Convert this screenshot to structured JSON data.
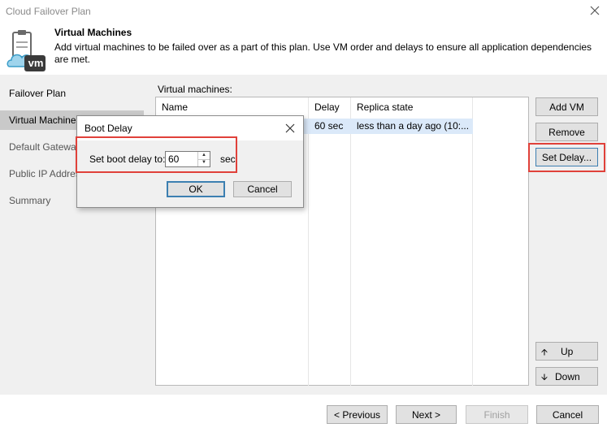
{
  "window": {
    "title": "Cloud Failover Plan"
  },
  "header": {
    "title": "Virtual Machines",
    "description": "Add virtual machines to be failed over as a part of this plan. Use VM order and delays to ensure all application dependencies are met.",
    "icon_label": "vm"
  },
  "nav": {
    "items": [
      {
        "label": "Failover Plan",
        "state": "normal"
      },
      {
        "label": "Virtual Machines",
        "state": "active"
      },
      {
        "label": "Default Gateways",
        "state": "disabled"
      },
      {
        "label": "Public IP Addresses",
        "state": "disabled"
      },
      {
        "label": "Summary",
        "state": "disabled"
      }
    ]
  },
  "vm_list": {
    "label": "Virtual machines:",
    "columns": [
      "Name",
      "Delay",
      "Replica state"
    ],
    "rows": [
      {
        "name": "",
        "delay": "60 sec",
        "replica_state": "less than a day ago (10:..."
      }
    ]
  },
  "side_buttons": {
    "add_vm": "Add VM",
    "remove": "Remove",
    "set_delay": "Set Delay...",
    "up": "Up",
    "down": "Down"
  },
  "footer": {
    "previous": "< Previous",
    "next": "Next >",
    "finish": "Finish",
    "cancel": "Cancel"
  },
  "dialog": {
    "title": "Boot Delay",
    "field_label": "Set boot delay to:",
    "value": "60",
    "unit": "sec",
    "ok": "OK",
    "cancel": "Cancel"
  },
  "colors": {
    "highlight": "#e0413a",
    "selection": "#dbe9f9",
    "nav_active": "#c9c9c9",
    "panel_bg": "#f0f0f0"
  }
}
